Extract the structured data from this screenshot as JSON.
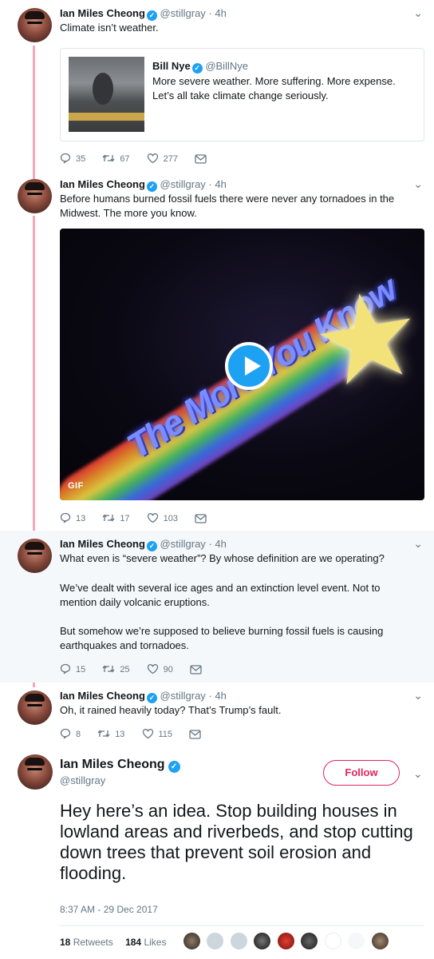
{
  "thread": [
    {
      "name": "Ian Miles Cheong",
      "handle": "@stillgray",
      "time": "4h",
      "text": "Climate isn’t weather.",
      "quote": {
        "name": "Bill Nye",
        "handle": "@BillNye",
        "text": "More severe weather. More suffering. More expense. Let’s all take climate change seriously."
      },
      "replies": "35",
      "retweets": "67",
      "likes": "277"
    },
    {
      "name": "Ian Miles Cheong",
      "handle": "@stillgray",
      "time": "4h",
      "text": "Before humans burned fossil fuels there were never any tornadoes in the Midwest. The more you know.",
      "media_badge": "GIF",
      "replies": "13",
      "retweets": "17",
      "likes": "103"
    },
    {
      "name": "Ian Miles Cheong",
      "handle": "@stillgray",
      "time": "4h",
      "paragraphs": [
        "What even is “severe weather”? By whose definition are we operating?",
        "We’ve dealt with several ice ages and an extinction level event. Not to mention daily volcanic eruptions.",
        "But somehow we’re supposed to believe burning fossil fuels is causing earthquakes and tornadoes."
      ],
      "replies": "15",
      "retweets": "25",
      "likes": "90"
    },
    {
      "name": "Ian Miles Cheong",
      "handle": "@stillgray",
      "time": "4h",
      "text": "Oh, it rained heavily today? That’s Trump’s fault.",
      "replies": "8",
      "retweets": "13",
      "likes": "115"
    }
  ],
  "main_tweet": {
    "name": "Ian Miles Cheong",
    "handle": "@stillgray",
    "follow_label": "Follow",
    "text": "Hey here’s an idea. Stop building houses in lowland areas and riverbeds, and stop cutting down trees that prevent soil erosion and flooding.",
    "timestamp": "8:37 AM - 29 Dec 2017",
    "retweet_count": "18",
    "retweet_label": "Retweets",
    "like_count": "184",
    "like_label": "Likes"
  },
  "colors": {
    "accent": "#1da1f2",
    "follow": "#e0245e",
    "thread_line": "#f4a9b8",
    "muted": "#657786"
  },
  "icons": [
    "reply-icon",
    "retweet-icon",
    "like-icon",
    "message-icon",
    "verified-icon",
    "chevron-down-icon",
    "play-icon"
  ]
}
